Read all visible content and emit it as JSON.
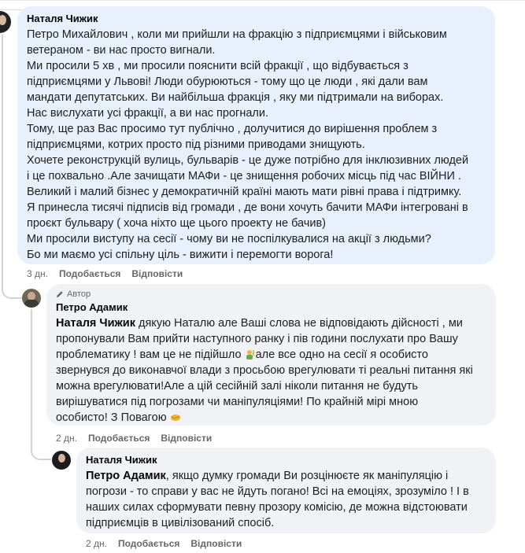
{
  "comments": [
    {
      "author": "Наталя Чижик",
      "lines": [
        "Петро Михайлович , коли ми прийшли на фракцію з підприємцями і військовим",
        "ветераном - ви нас просто вигнали.",
        "Ми просили 5 хв , ми просили пояснити всій фракції , що відбувається з",
        "підприємцями у Львові! Люди обурюються - тому що це люди , які дали вам",
        "мандати депутатських. Ви найбільша фракція , яку ми підтримали на виборах.",
        "Нас вислухати усі фракції, а ви нас прогнали.",
        "Тому, ще раз Вас просимо тут публічно , долучитися до вирішення проблем з",
        "підприємцями, котрих просто під різними приводами знищують.",
        "Хочете реконструкцій вулиць, бульварів - це дуже потрібно для інклюзивних людей",
        "і це похвально .Але зачищати МАФи - це знищення робочих місць під час ВІЙНИ .",
        "Великий і малий бізнес у демократичній країні мають мати рівні права і підтримку.",
        "Я принесла тисячі підписів від громади , де вони хочуть бачити МАФи інтегровані в",
        "проєкт бульвару ( хоча ніхто ще цього проекту не бачив)",
        "Ми просили виступу на сесії - чому ви не поспілкувалися на акції з людьми?",
        "Бо ми маємо усі спільну ціль - вижити і перемогти ворога!"
      ],
      "time": "3 дн.",
      "like": "Подобається",
      "reply": "Відповісти"
    },
    {
      "badge": "Автор",
      "author": "Петро Адамик",
      "mention": "Наталя Чижик",
      "line1_rest": " дякую Наталю але Ваші слова не відповідають дійсності , ми",
      "line2": "пропонували Вам прийти наступного ранку і пів години послухати про Вашу",
      "line3a": "проблематику ! вам це не підійшло ",
      "line3b": "але все одно на сесії я особисто",
      "line4": "звернувся до виконавчої влади з просьбою врегулювати ті реальні питання які",
      "line5": "можна врегулювати!Але а цій сесійній залі ніколи питання не будуть",
      "line6": "вирішуватися під погрозами чи маніпуляціями! По крайній мірі мною",
      "line7": "особисто! З Повагою ",
      "time": "2 дн.",
      "like": "Подобається",
      "reply": "Відповісти"
    },
    {
      "author": "Наталя Чижик",
      "mention": "Петро Адамик",
      "line1_rest": ", якщо думку громади Ви розцінюєте як маніпуляцію і",
      "line2": "погрози - то справи у вас не йдуть погано! Всі на емоціях, зрозуміло ! І в",
      "line3": "наших силах сформувати певну прозору комісію, де можна відстоювати",
      "line4": "підприємців в цивілізований спосіб.",
      "time": "2 дн.",
      "like": "Подобається",
      "reply": "Відповісти"
    }
  ],
  "icons": {
    "author_badge": "pencil-icon",
    "emoji_1": "person-raising-hand-emoji",
    "emoji_2": "handshake-emoji"
  }
}
